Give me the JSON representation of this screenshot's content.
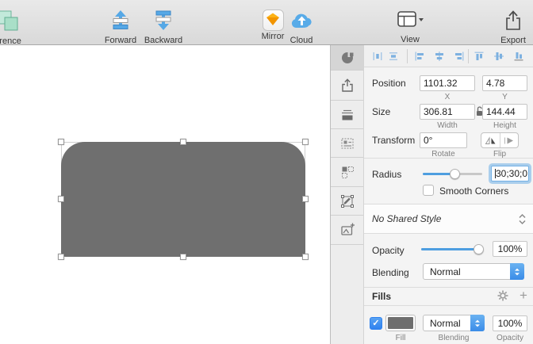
{
  "toolbar": {
    "items": [
      {
        "label": "erence",
        "icon": "boolean-difference-icon"
      },
      {
        "label": "Forward",
        "icon": "bring-forward-icon"
      },
      {
        "label": "Backward",
        "icon": "send-backward-icon"
      },
      {
        "label": "Mirror",
        "icon": "sketch-mirror-icon"
      },
      {
        "label": "Cloud",
        "icon": "cloud-upload-icon"
      },
      {
        "label": "View",
        "icon": "view-layout-icon"
      },
      {
        "label": "Export",
        "icon": "export-icon"
      }
    ]
  },
  "inspector": {
    "sidebar_icons": [
      "style-tab-icon",
      "share-icon",
      "artboard-icon",
      "form-icon",
      "selection-icon",
      "vector-edit-icon",
      "image-add-icon"
    ],
    "alignment_icons": [
      "distribute-horizontally",
      "distribute-vertically",
      "align-left",
      "align-center-horizontal",
      "align-right",
      "align-top",
      "align-middle-vertical",
      "align-bottom"
    ],
    "position": {
      "label": "Position",
      "x": "1101.32",
      "x_label": "X",
      "y": "4.78",
      "y_label": "Y"
    },
    "size": {
      "label": "Size",
      "width": "306.81",
      "width_label": "Width",
      "height": "144.44",
      "height_label": "Height"
    },
    "transform": {
      "label": "Transform",
      "rotate": "0°",
      "rotate_label": "Rotate",
      "flip_label": "Flip"
    },
    "radius": {
      "label": "Radius",
      "value": "30;30;0",
      "smooth_label": "Smooth Corners"
    },
    "shared_style": {
      "label": "No Shared Style"
    },
    "style": {
      "opacity_label": "Opacity",
      "opacity": "100%",
      "blending_label": "Blending",
      "blending": "Normal"
    },
    "fills": {
      "header": "Fills",
      "add": "+",
      "fill_label": "Fill",
      "blending": "Normal",
      "blending_label": "Blending",
      "opacity": "100%",
      "opacity_label": "Opacity"
    }
  },
  "colors": {
    "shape_fill": "#6F6F6F",
    "fill_swatch": "#6E6E6E",
    "accent_blue": "#4E9EE0",
    "checkbox_blue": "#2F82EF",
    "toolbar_icon_blue": "#56A8E6",
    "mirror_orange": "#F5A01A"
  }
}
